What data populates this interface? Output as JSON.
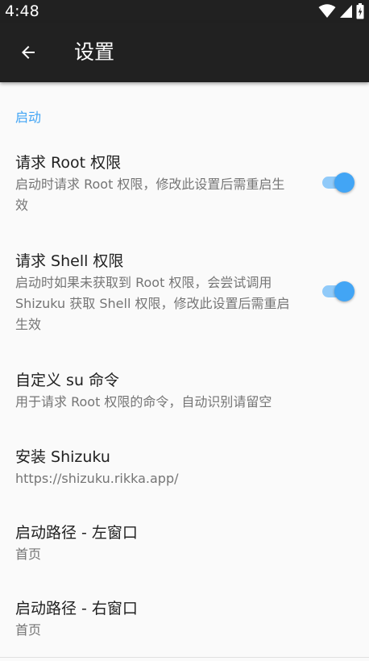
{
  "status_bar": {
    "time": "4:48"
  },
  "app_bar": {
    "title": "设置"
  },
  "section": {
    "header": "启动"
  },
  "prefs": [
    {
      "title": "请求 Root 权限",
      "summary": "启动时请求 Root 权限，修改此设置后需重启生效",
      "toggle": true
    },
    {
      "title": "请求 Shell 权限",
      "summary": "启动时如果未获取到 Root 权限，会尝试调用 Shizuku 获取 Shell 权限，修改此设置后需重启生效",
      "toggle": true
    },
    {
      "title": "自定义 su 命令",
      "summary": "用于请求 Root 权限的命令，自动识别请留空"
    },
    {
      "title": "安装 Shizuku",
      "summary": "https://shizuku.rikka.app/"
    },
    {
      "title": "启动路径 - 左窗口",
      "summary": "首页"
    },
    {
      "title": "启动路径 - 右窗口",
      "summary": "首页"
    }
  ],
  "colors": {
    "accent": "#42a5f5",
    "accent_track": "#90caf9",
    "app_bar": "#212121",
    "background": "#fafafa"
  },
  "icons": {
    "back": "arrow-back-icon",
    "wifi": "wifi-icon",
    "signal": "cell-signal-icon",
    "battery": "battery-charging-icon"
  }
}
